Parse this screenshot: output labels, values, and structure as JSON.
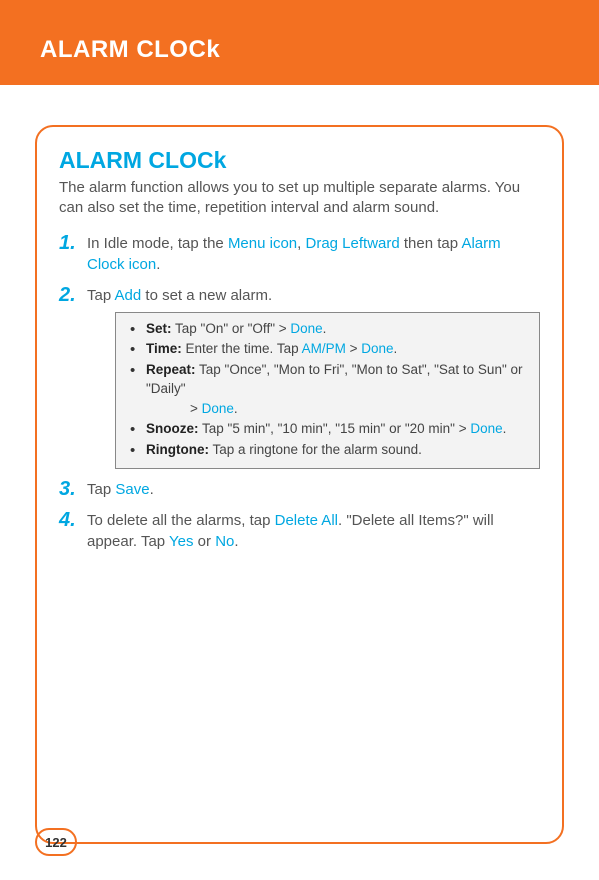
{
  "header": {
    "title_main": "ALARM CLOC",
    "title_tail": "k"
  },
  "section": {
    "title_main": "ALARM CLOC",
    "title_tail": "k"
  },
  "intro": "The alarm function allows you to set up multiple separate alarms. You can also set the time, repetition interval and alarm sound.",
  "steps": {
    "s1": {
      "pre": "In Idle mode, tap the ",
      "link1": "Menu icon",
      "mid1": ", ",
      "link2": "Drag Leftward",
      "mid2": " then tap ",
      "link3": "Alarm Clock icon",
      "post": "."
    },
    "s2": {
      "pre": "Tap ",
      "link1": "Add",
      "post": " to set a new alarm."
    },
    "s3": {
      "pre": "Tap ",
      "link1": "Save",
      "post": "."
    },
    "s4": {
      "pre": "To delete all the alarms, tap ",
      "link1": "Delete All",
      "mid1": ". \"Delete all Items?\" will appear. Tap ",
      "link2": "Yes",
      "mid2": " or ",
      "link3": "No",
      "post": "."
    }
  },
  "infobox": {
    "set": {
      "label": "Set:",
      "t1": " Tap \"On\" or \"Off\" > ",
      "d1": "Done",
      "t2": "."
    },
    "time": {
      "label": "Time:",
      "t1": " Enter the time. Tap ",
      "d1": "AM/PM",
      "t2": " > ",
      "d2": "Done",
      "t3": "."
    },
    "repeat": {
      "label": "Repeat:",
      "t1": " Tap \"Once\", \"Mon to Fri\", \"Mon to Sat\", \"Sat to Sun\" or \"Daily\"",
      "cont_pre": "> ",
      "d1": "Done",
      "cont_post": "."
    },
    "snooze": {
      "label": "Snooze:",
      "t1": " Tap \"5 min\", \"10 min\", \"15 min\" or \"20 min\" > ",
      "d1": "Done",
      "t2": "."
    },
    "ring": {
      "label": "Ringtone:",
      "t1": " Tap a ringtone for the alarm sound."
    }
  },
  "page_number": "122"
}
